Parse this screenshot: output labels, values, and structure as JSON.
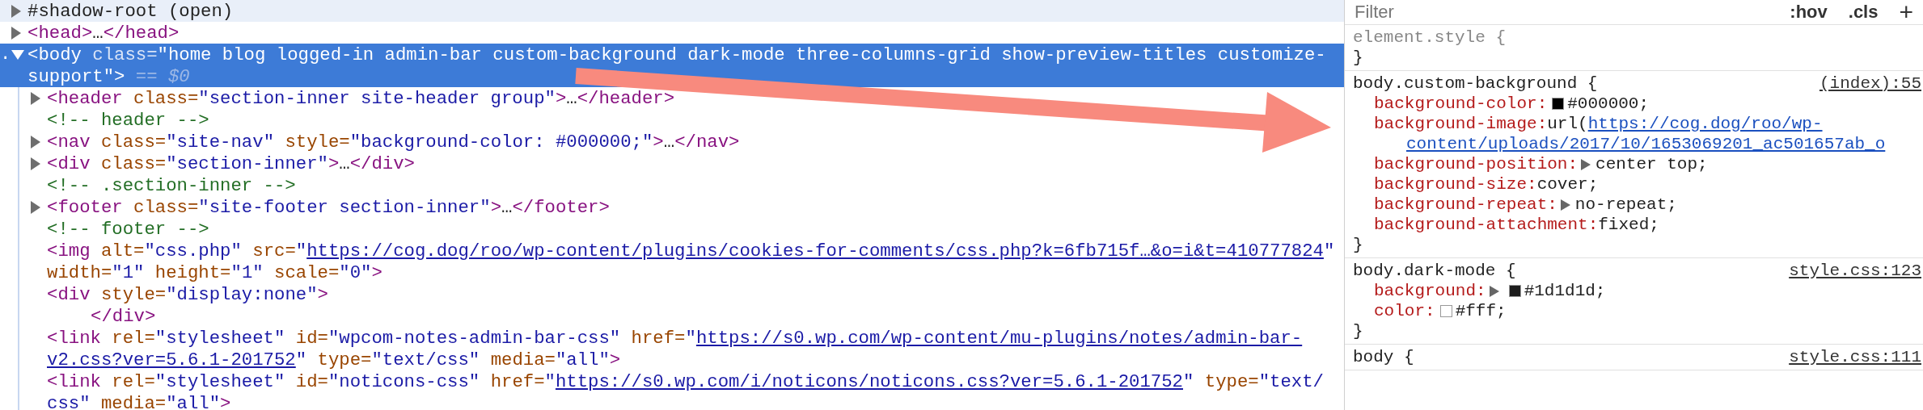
{
  "dom_tree": {
    "nodes": [
      {
        "hovered": true,
        "selected": false,
        "expanded": false,
        "lines": [
          {
            "kind": "code",
            "tokens": [
              {
                "kind": "text",
                "text": "#shadow-root (open)"
              }
            ]
          }
        ]
      },
      {
        "hovered": false,
        "selected": false,
        "expanded": false,
        "lines": [
          {
            "kind": "code",
            "tokens": [
              {
                "kind": "tag",
                "text": "<head>"
              },
              {
                "kind": "text",
                "text": "…"
              },
              {
                "kind": "tag",
                "text": "</head>"
              }
            ]
          }
        ]
      },
      {
        "hovered": false,
        "selected": true,
        "expanded": true,
        "marker": ".",
        "lines": [
          {
            "kind": "code",
            "tokens": [
              {
                "kind": "tag",
                "text": "<body"
              },
              {
                "kind": "attr",
                "text": " class="
              },
              {
                "kind": "value",
                "text": "\"home blog logged-in admin-bar custom-background dark-mode three-columns-grid show-preview-titles customize-"
              }
            ]
          },
          {
            "kind": "code",
            "tokens": [
              {
                "kind": "value",
                "text": "support\""
              },
              {
                "kind": "tag",
                "text": ">"
              },
              {
                "kind": "eq",
                "text": " == "
              },
              {
                "kind": "var",
                "text": "$0"
              }
            ]
          }
        ],
        "children": [
          {
            "hovered": false,
            "selected": false,
            "expanded": false,
            "lines": [
              {
                "kind": "code",
                "tokens": [
                  {
                    "kind": "tag",
                    "text": "<header"
                  },
                  {
                    "kind": "attr",
                    "text": " class="
                  },
                  {
                    "kind": "value",
                    "text": "\"section-inner site-header group\""
                  },
                  {
                    "kind": "tag",
                    "text": ">"
                  },
                  {
                    "kind": "text",
                    "text": "…"
                  },
                  {
                    "kind": "tag",
                    "text": "</header>"
                  }
                ]
              }
            ]
          },
          {
            "hovered": false,
            "selected": false,
            "lines": [
              {
                "kind": "code",
                "tokens": [
                  {
                    "kind": "comment",
                    "text": "<!-- header -->"
                  }
                ]
              }
            ]
          },
          {
            "hovered": false,
            "selected": false,
            "expanded": false,
            "lines": [
              {
                "kind": "code",
                "tokens": [
                  {
                    "kind": "tag",
                    "text": "<nav"
                  },
                  {
                    "kind": "attr",
                    "text": " class="
                  },
                  {
                    "kind": "value",
                    "text": "\"site-nav\""
                  },
                  {
                    "kind": "attr",
                    "text": " style="
                  },
                  {
                    "kind": "value",
                    "text": "\"background-color: #000000;\""
                  },
                  {
                    "kind": "tag",
                    "text": ">"
                  },
                  {
                    "kind": "text",
                    "text": "…"
                  },
                  {
                    "kind": "tag",
                    "text": "</nav>"
                  }
                ]
              }
            ]
          },
          {
            "hovered": false,
            "selected": false,
            "expanded": false,
            "lines": [
              {
                "kind": "code",
                "tokens": [
                  {
                    "kind": "tag",
                    "text": "<div"
                  },
                  {
                    "kind": "attr",
                    "text": " class="
                  },
                  {
                    "kind": "value",
                    "text": "\"section-inner\""
                  },
                  {
                    "kind": "tag",
                    "text": ">"
                  },
                  {
                    "kind": "text",
                    "text": "…"
                  },
                  {
                    "kind": "tag",
                    "text": "</div>"
                  }
                ]
              }
            ]
          },
          {
            "hovered": false,
            "selected": false,
            "lines": [
              {
                "kind": "code",
                "tokens": [
                  {
                    "kind": "comment",
                    "text": "<!-- .section-inner -->"
                  }
                ]
              }
            ]
          },
          {
            "hovered": false,
            "selected": false,
            "expanded": false,
            "lines": [
              {
                "kind": "code",
                "tokens": [
                  {
                    "kind": "tag",
                    "text": "<footer"
                  },
                  {
                    "kind": "attr",
                    "text": " class="
                  },
                  {
                    "kind": "value",
                    "text": "\"site-footer section-inner\""
                  },
                  {
                    "kind": "tag",
                    "text": ">"
                  },
                  {
                    "kind": "text",
                    "text": "…"
                  },
                  {
                    "kind": "tag",
                    "text": "</footer>"
                  }
                ]
              }
            ]
          },
          {
            "hovered": false,
            "selected": false,
            "lines": [
              {
                "kind": "code",
                "tokens": [
                  {
                    "kind": "comment",
                    "text": "<!-- footer -->"
                  }
                ]
              }
            ]
          },
          {
            "hovered": false,
            "selected": false,
            "lines": [
              {
                "kind": "code",
                "tokens": [
                  {
                    "kind": "tag",
                    "text": "<img"
                  },
                  {
                    "kind": "attr",
                    "text": " alt="
                  },
                  {
                    "kind": "value",
                    "text": "\"css.php\""
                  },
                  {
                    "kind": "attr",
                    "text": " src="
                  },
                  {
                    "kind": "value",
                    "text": "\""
                  },
                  {
                    "kind": "link",
                    "text": "https://cog.dog/roo/wp-content/plugins/cookies-for-comments/css.php?k=6fb715f…&o=i&t=410777824"
                  },
                  {
                    "kind": "value",
                    "text": "\""
                  }
                ]
              },
              {
                "kind": "code",
                "tokens": [
                  {
                    "kind": "attr",
                    "text": "width="
                  },
                  {
                    "kind": "value",
                    "text": "\"1\""
                  },
                  {
                    "kind": "attr",
                    "text": " height="
                  },
                  {
                    "kind": "value",
                    "text": "\"1\""
                  },
                  {
                    "kind": "attr",
                    "text": " scale="
                  },
                  {
                    "kind": "value",
                    "text": "\"0\""
                  },
                  {
                    "kind": "tag",
                    "text": ">"
                  }
                ]
              }
            ]
          },
          {
            "hovered": false,
            "selected": false,
            "lines": [
              {
                "kind": "code",
                "tokens": [
                  {
                    "kind": "tag",
                    "text": "<div"
                  },
                  {
                    "kind": "attr",
                    "text": " style="
                  },
                  {
                    "kind": "value",
                    "text": "\"display:none\""
                  },
                  {
                    "kind": "tag",
                    "text": ">"
                  }
                ]
              },
              {
                "kind": "closing",
                "tokens": [
                  {
                    "kind": "tag",
                    "text": "</div>"
                  }
                ]
              }
            ]
          },
          {
            "hovered": false,
            "selected": false,
            "lines": [
              {
                "kind": "code",
                "tokens": [
                  {
                    "kind": "tag",
                    "text": "<link"
                  },
                  {
                    "kind": "attr",
                    "text": " rel="
                  },
                  {
                    "kind": "value",
                    "text": "\"stylesheet\""
                  },
                  {
                    "kind": "attr",
                    "text": " id="
                  },
                  {
                    "kind": "value",
                    "text": "\"wpcom-notes-admin-bar-css\""
                  },
                  {
                    "kind": "attr",
                    "text": " href="
                  },
                  {
                    "kind": "value",
                    "text": "\""
                  },
                  {
                    "kind": "link",
                    "text": "https://s0.wp.com/wp-content/mu-plugins/notes/admin-bar-"
                  }
                ]
              },
              {
                "kind": "code",
                "tokens": [
                  {
                    "kind": "link",
                    "text": "v2.css?ver=5.6.1-201752"
                  },
                  {
                    "kind": "value",
                    "text": "\""
                  },
                  {
                    "kind": "attr",
                    "text": " type="
                  },
                  {
                    "kind": "value",
                    "text": "\"text/css\""
                  },
                  {
                    "kind": "attr",
                    "text": " media="
                  },
                  {
                    "kind": "value",
                    "text": "\"all\""
                  },
                  {
                    "kind": "tag",
                    "text": ">"
                  }
                ]
              }
            ]
          },
          {
            "hovered": false,
            "selected": false,
            "lines": [
              {
                "kind": "code",
                "tokens": [
                  {
                    "kind": "tag",
                    "text": "<link"
                  },
                  {
                    "kind": "attr",
                    "text": " rel="
                  },
                  {
                    "kind": "value",
                    "text": "\"stylesheet\""
                  },
                  {
                    "kind": "attr",
                    "text": " id="
                  },
                  {
                    "kind": "value",
                    "text": "\"noticons-css\""
                  },
                  {
                    "kind": "attr",
                    "text": " href="
                  },
                  {
                    "kind": "value",
                    "text": "\""
                  },
                  {
                    "kind": "link",
                    "text": "https://s0.wp.com/i/noticons/noticons.css?ver=5.6.1-201752"
                  },
                  {
                    "kind": "value",
                    "text": "\""
                  },
                  {
                    "kind": "attr",
                    "text": " type="
                  },
                  {
                    "kind": "value",
                    "text": "\"text/"
                  }
                ]
              },
              {
                "kind": "code",
                "tokens": [
                  {
                    "kind": "value",
                    "text": "css\""
                  },
                  {
                    "kind": "attr",
                    "text": " media="
                  },
                  {
                    "kind": "value",
                    "text": "\"all\""
                  },
                  {
                    "kind": "tag",
                    "text": ">"
                  }
                ]
              }
            ]
          }
        ]
      }
    ]
  },
  "styles_pane": {
    "filter": {
      "placeholder": "Filter"
    },
    "toolbar": [
      {
        "kind": "hov",
        "label": ":hov"
      },
      {
        "kind": "cls",
        "label": ".cls"
      },
      {
        "kind": "add",
        "label": "+"
      }
    ],
    "rules": [
      {
        "kind": "inline",
        "selector": "element.style {",
        "close": "}"
      },
      {
        "kind": "matched",
        "selector": "body.custom-background {",
        "source": "(index):55",
        "declarations": [
          {
            "property": "background-color:",
            "swatch": true,
            "value": [
              {
                "kind": "text",
                "text": "#000000;"
              }
            ]
          },
          {
            "property": "background-image:",
            "value": [
              {
                "kind": "text",
                "text": "url("
              },
              {
                "kind": "link",
                "text": "https://cog.dog/roo/wp-"
              }
            ],
            "continuation": [
              {
                "kind": "link",
                "text": "content/uploads/2017/10/1653069201_ac501657ab_o"
              }
            ]
          },
          {
            "property": "background-position:",
            "expandable": true,
            "value": [
              {
                "kind": "text",
                "text": "center top;"
              }
            ]
          },
          {
            "property": "background-size:",
            "value": [
              {
                "kind": "text",
                "text": "cover;"
              }
            ]
          },
          {
            "property": "background-repeat:",
            "expandable": true,
            "value": [
              {
                "kind": "text",
                "text": "no-repeat;"
              }
            ]
          },
          {
            "property": "background-attachment:",
            "value": [
              {
                "kind": "text",
                "text": "fixed;"
              }
            ]
          }
        ],
        "close": "}"
      },
      {
        "kind": "matched",
        "selector": "body.dark-mode {",
        "source": "style.css:123",
        "declarations": [
          {
            "property": "background:",
            "expandable": true,
            "swatch": true,
            "value": [
              {
                "kind": "text",
                "text": "#1d1d1d;"
              }
            ]
          },
          {
            "property": "color:",
            "swatch": true,
            "value": [
              {
                "kind": "text",
                "text": "#fff;"
              }
            ]
          }
        ],
        "close": "}"
      },
      {
        "kind": "matched",
        "selector": "body {",
        "source": "style.css:111"
      }
    ]
  }
}
